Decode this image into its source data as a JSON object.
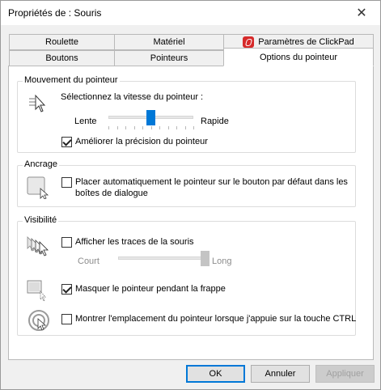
{
  "window": {
    "title": "Propriétés de : Souris",
    "close_label": "✕"
  },
  "tabs": {
    "row1": [
      {
        "label": "Roulette"
      },
      {
        "label": "Matériel"
      },
      {
        "label": "Paramètres de ClickPad"
      }
    ],
    "row2": [
      {
        "label": "Boutons"
      },
      {
        "label": "Pointeurs"
      },
      {
        "label": "Options du pointeur",
        "active": true
      }
    ]
  },
  "motion": {
    "title": "Mouvement du pointeur",
    "speed_label": "Sélectionnez la vitesse du pointeur :",
    "slow_label": "Lente",
    "fast_label": "Rapide",
    "speed_value_fraction": 0.5,
    "precision_label": "Améliorer la précision du pointeur",
    "precision_checked": true
  },
  "snap": {
    "title": "Ancrage",
    "label": "Placer automatiquement le pointeur sur le bouton par défaut dans les",
    "label_line2": "boîtes de dialogue",
    "checked": false
  },
  "visibility": {
    "title": "Visibilité",
    "trails_label": "Afficher les traces de la souris",
    "trails_checked": false,
    "short_label": "Court",
    "long_label": "Long",
    "trails_value_fraction": 1.0,
    "hide_label": "Masquer le pointeur pendant la frappe",
    "hide_checked": true,
    "ctrl_label": "Montrer l'emplacement du pointeur lorsque j'appuie sur la touche CTRL",
    "ctrl_checked": false
  },
  "buttons": {
    "ok": "OK",
    "cancel": "Annuler",
    "apply": "Appliquer"
  },
  "colors": {
    "accent": "#0078d7"
  }
}
